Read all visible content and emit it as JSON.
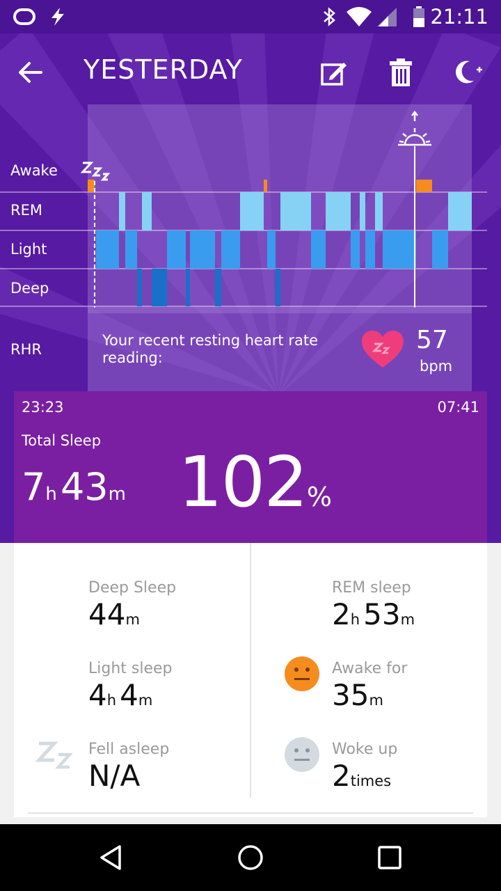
{
  "status_bar": {
    "time": "21:11"
  },
  "header": {
    "title": "YESTERDAY"
  },
  "chart": {
    "rows": [
      "Awake",
      "REM",
      "Light",
      "Deep"
    ],
    "colors": {
      "awake": "#f58c1f",
      "rem": "#86d2f5",
      "light": "#3a9cef",
      "deep": "#1a6fc9"
    }
  },
  "rhr": {
    "label": "RHR",
    "text": "Your recent resting heart rate reading:",
    "value": "57",
    "unit": "bpm"
  },
  "summary": {
    "start_time": "23:23",
    "end_time": "07:41",
    "total_label": "Total Sleep",
    "hours": "7",
    "hours_unit": "h",
    "minutes": "43",
    "minutes_unit": "m",
    "percent": "102",
    "percent_symbol": "%"
  },
  "stats": {
    "deep": {
      "label": "Deep Sleep",
      "value": "44",
      "unit": "m"
    },
    "rem": {
      "label": "REM sleep",
      "h": "2",
      "h_unit": "h",
      "m": "53",
      "m_unit": "m"
    },
    "light": {
      "label": "Light sleep",
      "h": "4",
      "h_unit": "h",
      "m": "4",
      "m_unit": "m"
    },
    "awake": {
      "label": "Awake for",
      "value": "35",
      "unit": "m"
    },
    "fell_asleep": {
      "label": "Fell asleep",
      "value": "N/A"
    },
    "woke_up": {
      "label": "Woke up",
      "value": "2",
      "unit": "times"
    }
  }
}
